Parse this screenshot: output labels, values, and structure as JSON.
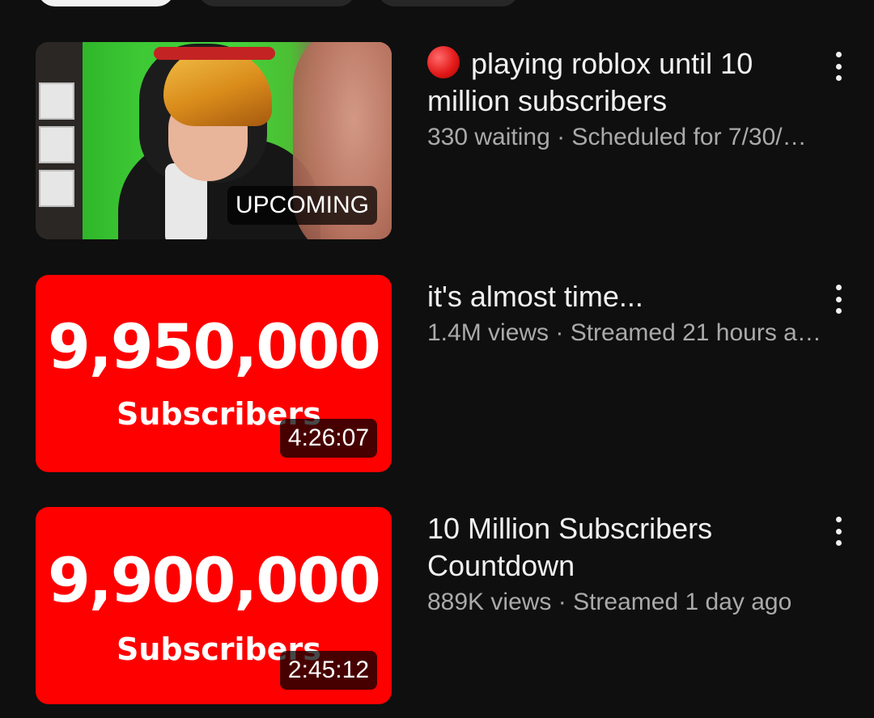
{
  "filters": {
    "chips": [
      "",
      "",
      ""
    ]
  },
  "videos": [
    {
      "title": "playing roblox until 10 million subscribers",
      "live_icon": "red-circle-icon",
      "meta": "330 waiting · Scheduled for 7/30/…",
      "badge": "UPCOMING",
      "thumb_count": "",
      "thumb_label": ""
    },
    {
      "title": "it's almost time...",
      "meta": "1.4M views · Streamed 21 hours a…",
      "badge": "4:26:07",
      "thumb_count": "9,950,000",
      "thumb_label": "Subscribers"
    },
    {
      "title": "10 Million Subscribers Countdown",
      "meta": "889K views · Streamed 1 day ago",
      "badge": "2:45:12",
      "thumb_count": "9,900,000",
      "thumb_label": "Subscribers"
    }
  ],
  "colors": {
    "background": "#0f0f0f",
    "thumbnail_red": "#fe0000",
    "meta_text": "#aaaaaa",
    "live_dot": "#e31b1b"
  }
}
